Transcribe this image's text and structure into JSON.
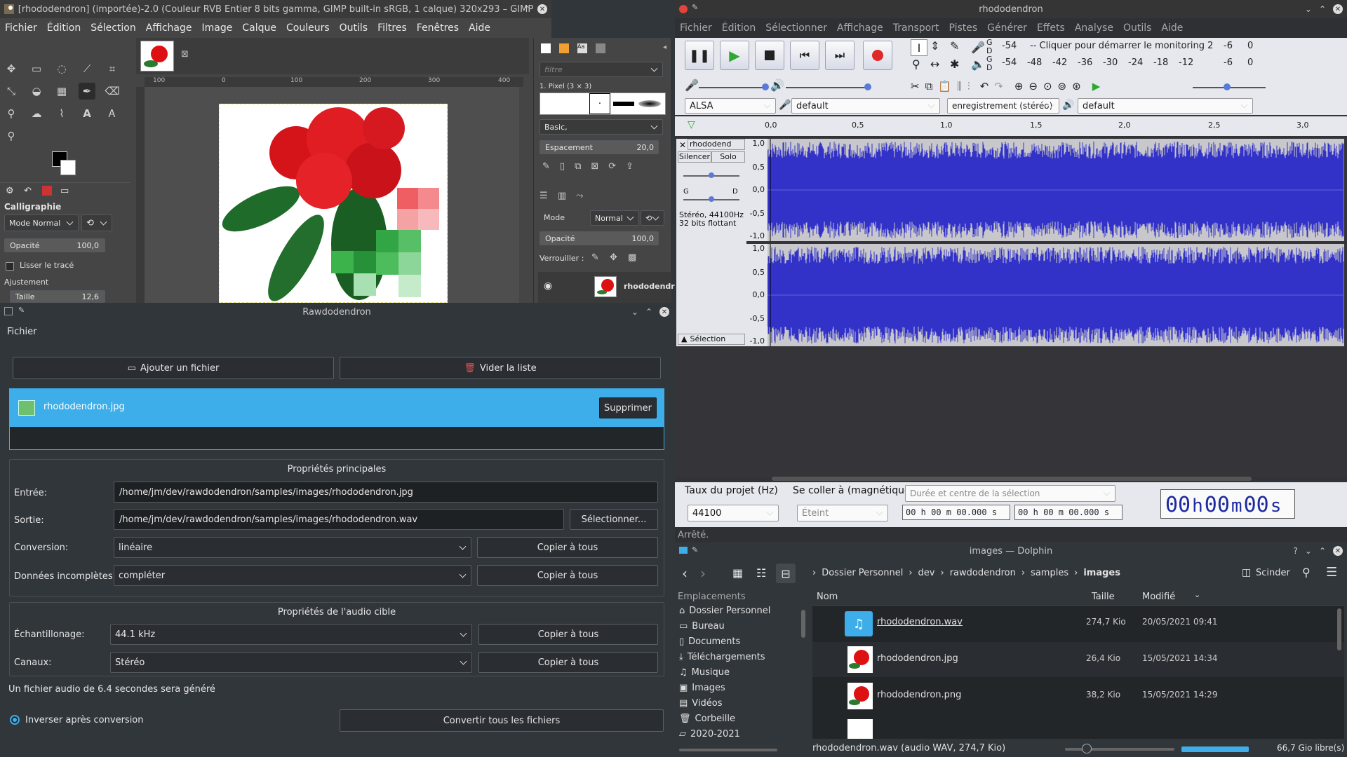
{
  "gimp": {
    "title": "[rhododendron] (importée)-2.0 (Couleur RVB Entier 8 bits gamma, GIMP built-in sRGB, 1 calque) 320x293 – GIMP",
    "menu": [
      "Fichier",
      "Édition",
      "Sélection",
      "Affichage",
      "Image",
      "Calque",
      "Couleurs",
      "Outils",
      "Filtres",
      "Fenêtres",
      "Aide"
    ],
    "tool_name": "Calligraphie",
    "mode_label": "Mode",
    "mode_value": "Normal",
    "opacity_label": "Opacité",
    "opacity_value": "100,0",
    "smooth_label": "Lisser le tracé",
    "adjust_label": "Ajustement",
    "size_label": "Taille",
    "size_value": "12,6",
    "filter_placeholder": "filtre",
    "brush_label": "1. Pixel (3 × 3)",
    "brush_preset": "Basic,",
    "spacing_label": "Espacement",
    "spacing_value": "20,0",
    "layers_mode_label": "Mode",
    "layers_mode_value": "Normal",
    "layers_opacity_label": "Opacité",
    "layers_opacity_value": "100,0",
    "lock_label": "Verrouiller :",
    "layer_name": "rhododendr",
    "ruler_ticks": [
      "100",
      "0",
      "100",
      "200",
      "300",
      "400"
    ]
  },
  "raw": {
    "title": "Rawdodendron",
    "menu_file": "Fichier",
    "add_file": "Ajouter un fichier",
    "clear_list": "Vider la liste",
    "file_item": "rhododendron.jpg",
    "delete": "Supprimer",
    "main_props": "Propriétés principales",
    "input_label": "Entrée:",
    "input_value": "/home/jm/dev/rawdodendron/samples/images/rhododendron.jpg",
    "output_label": "Sortie:",
    "output_value": "/home/jm/dev/rawdodendron/samples/images/rhododendron.wav",
    "select_btn": "Sélectionner...",
    "conversion_label": "Conversion:",
    "conversion_value": "linéaire",
    "incomplete_label": "Données incomplètes:",
    "incomplete_value": "compléter",
    "copy_all": "Copier à tous",
    "target_props": "Propriétés de l'audio cible",
    "sampling_label": "Échantillonage:",
    "sampling_value": "44.1 kHz",
    "channels_label": "Canaux:",
    "channels_value": "Stéréo",
    "info": "Un fichier audio de 6.4 secondes sera généré",
    "invert_label": "Inverser après conversion",
    "convert_all": "Convertir tous les fichiers"
  },
  "audacity": {
    "title": "rhododendron",
    "menu": [
      "Fichier",
      "Édition",
      "Sélectionner",
      "Affichage",
      "Transport",
      "Pistes",
      "Générer",
      "Effets",
      "Analyse",
      "Outils",
      "Aide"
    ],
    "meter_top": [
      "-54",
      "-- Cliquer pour démarrer le monitoring 2",
      "-6",
      "0"
    ],
    "meter_bottom": [
      "-54",
      "-48",
      "-42",
      "-36",
      "-30",
      "-24",
      "-18",
      "-12",
      "-6",
      "0"
    ],
    "meter_g": "G",
    "meter_d": "D",
    "host": "ALSA",
    "rec_device": "default",
    "rec_channels": "enregistrement (stéréo)",
    "play_device": "default",
    "timeline": [
      "0,0",
      "0,5",
      "1,0",
      "1,5",
      "2,0",
      "2,5",
      "3,0"
    ],
    "track_name": "rhododend",
    "mute": "Silencer",
    "solo": "Solo",
    "gain_l": "G",
    "gain_r": "D",
    "track_info1": "Stéréo, 44100Hz",
    "track_info2": "32 bits flottant",
    "selection_btn": "Sélection",
    "scale": [
      "1,0",
      "0,5",
      "0,0",
      "-0,5",
      "-1,0"
    ],
    "rate_label": "Taux du projet (Hz)",
    "rate_value": "44100",
    "snap_label": "Se coller à (magnétique)",
    "snap_value": "Éteint",
    "sel_combo": "Durée et centre de la sélection",
    "time_small": "00 h 00 m 00.000 s",
    "time_big_h": "00",
    "time_big_hl": "h",
    "time_big_m": "00",
    "time_big_ml": "m",
    "time_big_s": "00",
    "time_big_sl": "s",
    "status": "Arrêté.",
    "wave_color": "#3232c8"
  },
  "dolphin": {
    "title": "images — Dolphin",
    "breadcrumb": [
      "Dossier Personnel",
      "dev",
      "rawdodendron",
      "samples",
      "images"
    ],
    "split": "Scinder",
    "places_header": "Emplacements",
    "places": [
      "Dossier Personnel",
      "Bureau",
      "Documents",
      "Téléchargements",
      "Musique",
      "Images",
      "Vidéos",
      "Corbeille",
      "2020-2021"
    ],
    "col_name": "Nom",
    "col_size": "Taille",
    "col_modified": "Modifié",
    "files": [
      {
        "name": "rhododendron.wav",
        "size": "274,7 Kio",
        "date": "20/05/2021 09:41"
      },
      {
        "name": "rhododendron.jpg",
        "size": "26,4 Kio",
        "date": "15/05/2021 14:34"
      },
      {
        "name": "rhododendron.png",
        "size": "38,2 Kio",
        "date": "15/05/2021 14:29"
      }
    ],
    "status": "rhododendron.wav (audio WAV, 274,7 Kio)",
    "free": "66,7 Gio libre(s)"
  }
}
